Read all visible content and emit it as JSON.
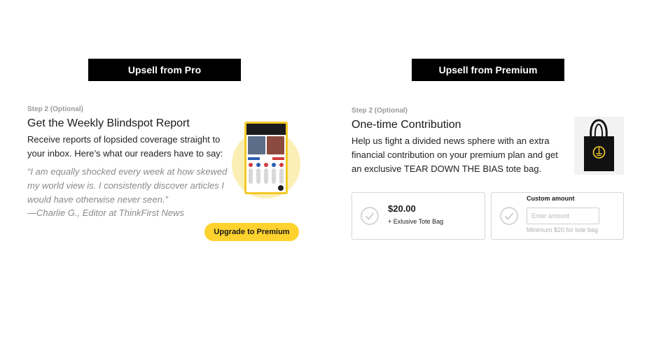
{
  "left": {
    "banner": "Upsell from Pro",
    "step": "Step 2 (Optional)",
    "title": "Get the Weekly Blindspot Report",
    "description": "Receive reports of lopsided coverage straight to your inbox. Here’s what our readers have to say:",
    "quote": "“I am equally shocked every week at how skewed my world view is. I consistently discover articles I would have otherwise never seen.”",
    "attribution": "—Charlie G., Editor at ThinkFirst News",
    "button_label": "Upgrade to Premium",
    "image_icon": "blindspot-report-phone-preview"
  },
  "right": {
    "banner": "Upsell from Premium",
    "step": "Step 2 (Optional)",
    "title": "One-time Contribution",
    "description": "Help us fight a divided news sphere with an extra financial contribution on your premium plan and get an exclusive TEAR DOWN THE BIAS tote bag.",
    "image_icon": "tote-bag-icon",
    "fixed_option": {
      "amount": "$20.00",
      "subtitle": "+ Exlusive Tote Bag"
    },
    "custom_option": {
      "label": "Custom amount",
      "placeholder": "Enter amount",
      "hint": "Minimum $20 for tote bag"
    }
  },
  "colors": {
    "accent_yellow": "#ffd22e",
    "banner_bg": "#000000"
  }
}
